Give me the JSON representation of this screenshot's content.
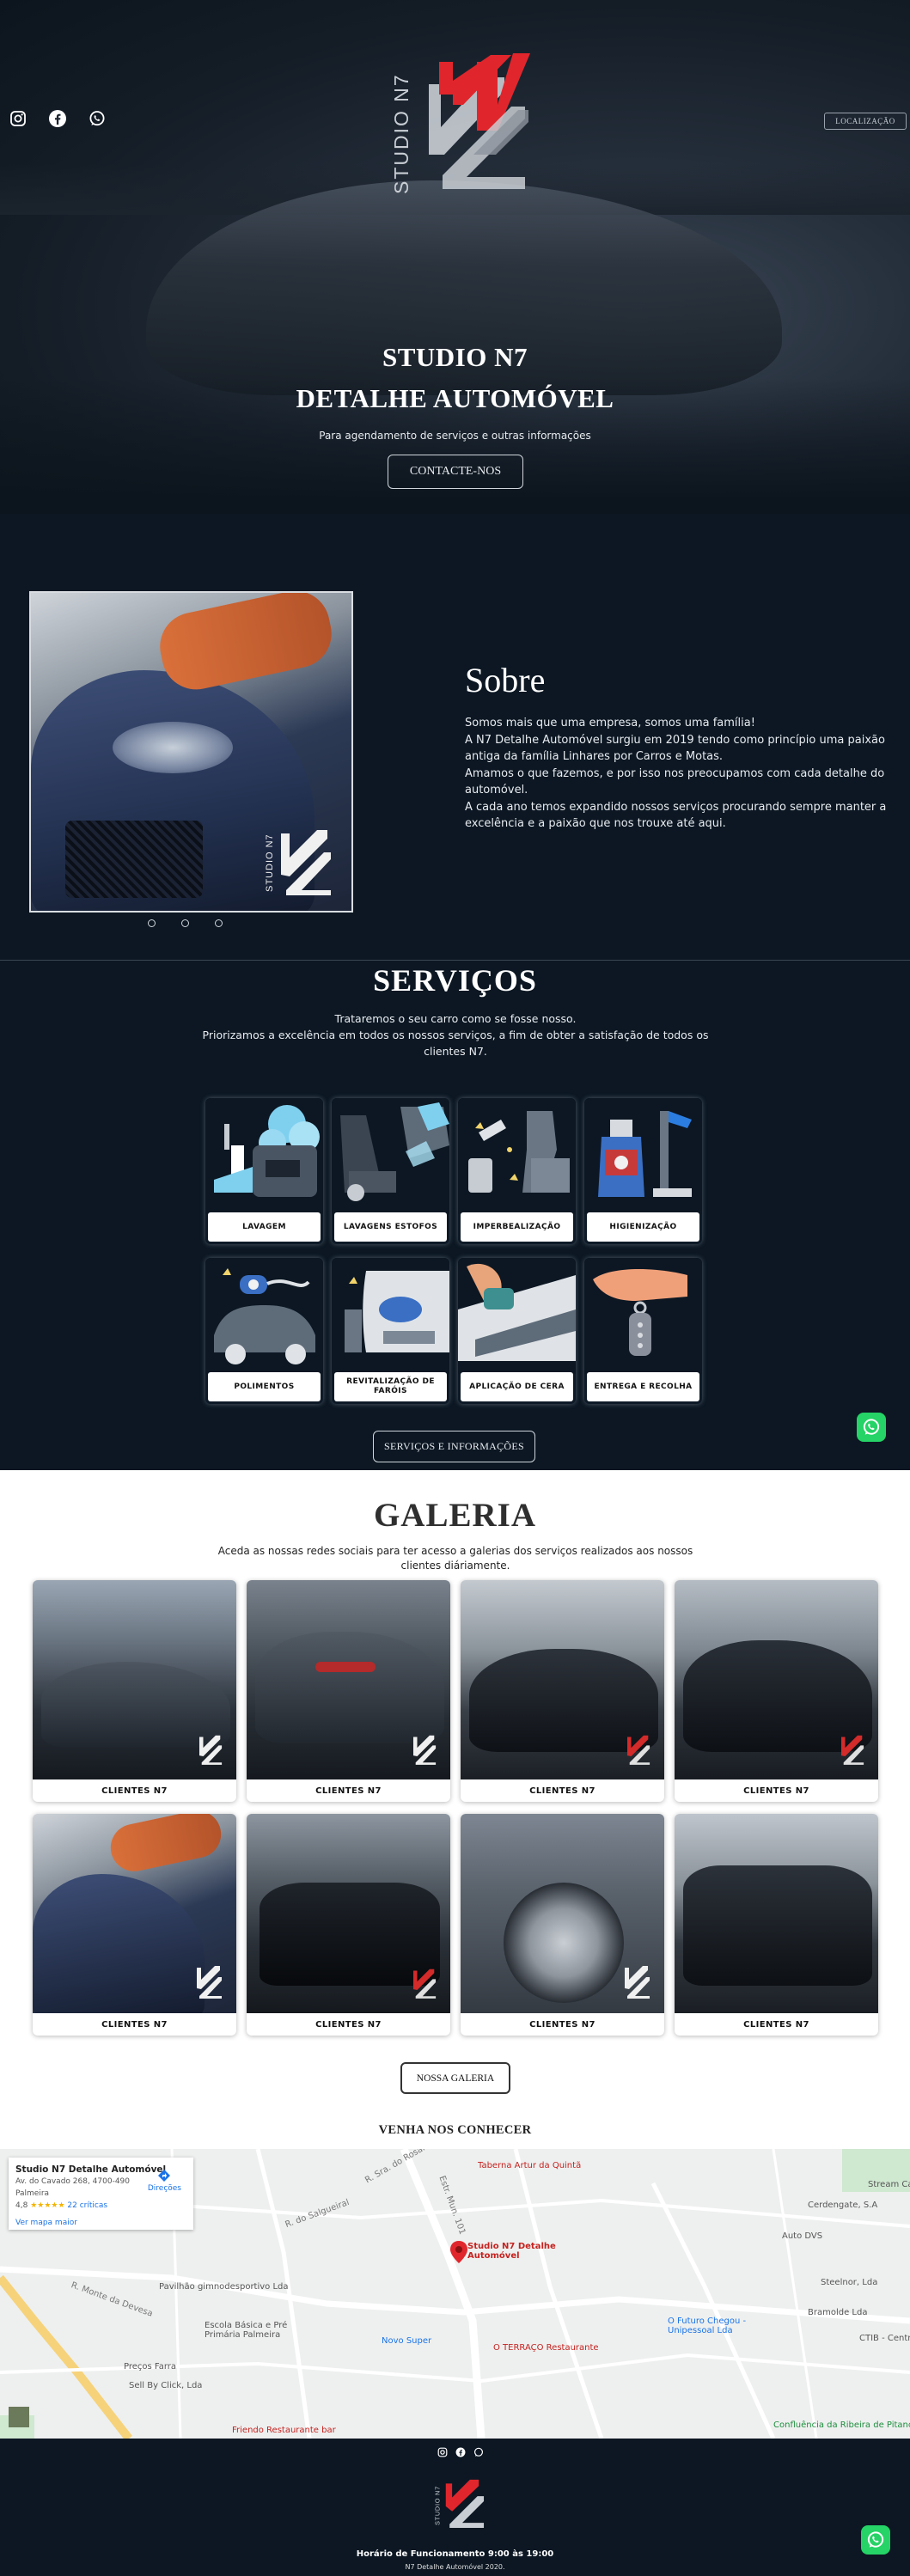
{
  "header": {
    "social_icons": [
      "instagram-icon",
      "facebook-icon",
      "whatsapp-icon"
    ],
    "location_button": "LOCALIZAÇÃO",
    "logo_text": "STUDIO N7"
  },
  "hero": {
    "title_line1": "STUDIO N7",
    "title_line2": "DETALHE AUTOMÓVEL",
    "subtitle": "Para agendamento de serviços e outras informações",
    "cta": "CONTACTE-NOS"
  },
  "sobre": {
    "title": "Sobre",
    "paragraphs": [
      "Somos mais que uma empresa, somos uma família!",
      "A N7 Detalhe Automóvel surgiu em 2019 tendo como princípio uma paixão antiga da família Linhares por Carros e Motas.",
      "Amamos o que fazemos, e por isso nos preocupamos com cada detalhe do automóvel.",
      "A cada ano temos expandido nossos serviços procurando sempre manter a excelência e a paixão que nos trouxe até aqui."
    ],
    "image_logo_text": "STUDIO N7"
  },
  "servicos": {
    "title": "SERVIÇOS",
    "subtitle_line1": "Trataremos o seu carro como se fosse nosso.",
    "subtitle_line2": "Priorizamos a excelência em todos os nossos serviços, a fim de obter a satisfação de todos os clientes N7.",
    "items": [
      {
        "label": "LAVAGEM"
      },
      {
        "label": "LAVAGENS ESTOFOS"
      },
      {
        "label": "IMPERBEALIZAÇÃO"
      },
      {
        "label": "HIGIENIZAÇÃO"
      },
      {
        "label": "POLIMENTOS"
      },
      {
        "label": "REVITALIZAÇÃO DE FARÓIS"
      },
      {
        "label": "APLICAÇÃO DE CERA"
      },
      {
        "label": "ENTREGA E RECOLHA"
      }
    ],
    "button": "SERVIÇOS E INFORMAÇÕES"
  },
  "galeria": {
    "title": "GALERIA",
    "subtitle": "Aceda as nossas redes sociais para ter acesso a galerias dos serviços realizados aos nossos clientes diáriamente.",
    "items": [
      {
        "label": "CLIENTES N7"
      },
      {
        "label": "CLIENTES N7"
      },
      {
        "label": "CLIENTES N7"
      },
      {
        "label": "CLIENTES N7"
      },
      {
        "label": "CLIENTES N7"
      },
      {
        "label": "CLIENTES N7"
      },
      {
        "label": "CLIENTES N7"
      },
      {
        "label": "CLIENTES N7"
      }
    ],
    "button": "NOSSA GALERIA"
  },
  "venha": {
    "title": "VENHA NOS CONHECER"
  },
  "map": {
    "place_name": "Studio N7 Detalhe Automóvel",
    "address_line1": "Av. do Cavado 268, 4700-490",
    "address_line2": "Palmeira",
    "rating": "4,8",
    "stars": "★★★★★",
    "reviews": "22 críticas",
    "directions": "Direções",
    "larger_map": "Ver mapa maior",
    "pin_label": "Studio N7 Detalhe Automóvel",
    "labels": [
      "Taberna Artur da Quintã",
      "Cerdengate, S.A",
      "Auto DVS",
      "Steelnor, Lda",
      "Bramolde Lda",
      "Pavilhão gimnodesportivo Lda",
      "Escola Básica e Pré Primária Palmeira",
      "Novo Super",
      "O Futuro Chegou - Unipessoal Lda",
      "O TERRAÇO Restaurante",
      "Preços Farra",
      "Sell By Click, Lda",
      "Friendo Restaurante bar",
      "Confluência da Ribeira de Pitancinho",
      "CTIB - Centro de Inspecções",
      "Stream Campo futebol",
      "R. Sra. do Rosário",
      "Estr. Mun. 101",
      "R. Monte da Devesa",
      "R. do Salgueiral"
    ]
  },
  "footer": {
    "social_icons": [
      "instagram-icon",
      "facebook-icon",
      "whatsapp-icon"
    ],
    "hours": "Horário de Funcionamento 9:00 às 19:00",
    "copyright": "N7 Detalhe Automóvel 2020."
  },
  "colors": {
    "background": "#0c1723",
    "logo_red": "#e0262c",
    "logo_grey": "#c9ced4",
    "whatsapp": "#25d366"
  }
}
